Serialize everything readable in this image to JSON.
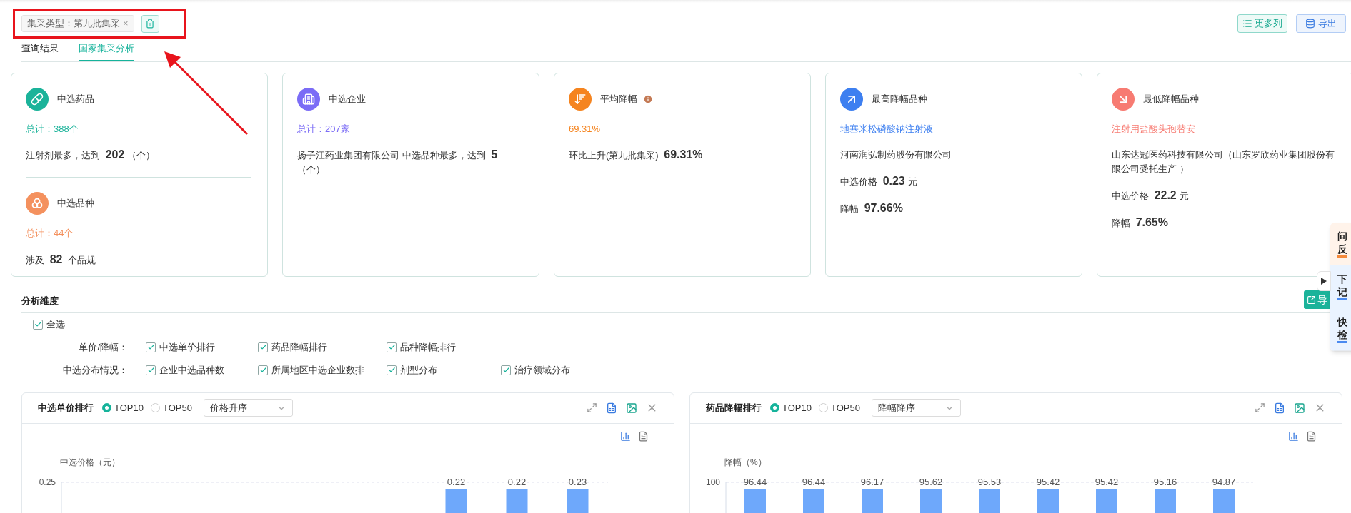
{
  "filter_bar": {
    "chips": [
      {
        "label": "集采类型：第九批集采",
        "close": "×"
      }
    ]
  },
  "toolbar": {
    "buttons": [
      {
        "label": "更多列",
        "kind": "columns"
      },
      {
        "label": "导出",
        "kind": "export"
      }
    ]
  },
  "tabs": [
    {
      "label": "查询结果",
      "selected": false
    },
    {
      "label": "国家集采分析",
      "selected": true
    }
  ],
  "cards": [
    {
      "sections": [
        {
          "title": "中选药品",
          "color": "#1bb39a",
          "highlight": "总计：388个",
          "lines": [
            "注射剂最多，达到 **202**（个）"
          ]
        },
        {
          "title": "中选品种",
          "color": "#f4915e",
          "highlight": "总计：44个",
          "lines": [
            "涉及 **82** 个品规"
          ]
        }
      ]
    },
    {
      "sections": [
        {
          "title": "中选企业",
          "color": "#7b6cf6",
          "highlight": "总计：207家",
          "lines": [
            "扬子江药业集团有限公司 中选品种最多，达到 **5**（个）"
          ]
        }
      ]
    },
    {
      "sections": [
        {
          "title": "平均降幅",
          "color": "#f5841f",
          "info": true,
          "highlight": "69.31%",
          "lines": [
            "环比上升(第九批集采) **69.31%**"
          ]
        }
      ]
    },
    {
      "sections": [
        {
          "title": "最高降幅品种",
          "color": "#3d7ff0",
          "highlight": "地塞米松磷酸钠注射液",
          "lines": [
            "河南润弘制药股份有限公司",
            "中选价格 **0.23**元",
            "降幅 **97.66%**"
          ]
        }
      ]
    },
    {
      "sections": [
        {
          "title": "最低降幅品种",
          "color": "#f77b72",
          "highlight": "注射用盐酸头孢替安",
          "lines": [
            "山东达冠医药科技有限公司（山东罗欣药业集团股份有限公司受托生产 ）",
            "中选价格 **22.2**元",
            "降幅 **7.65%**"
          ]
        }
      ]
    }
  ],
  "analysis": {
    "title": "分析维度",
    "export_button": "导",
    "select_all": {
      "label": "全选",
      "checked": true
    },
    "groups": [
      {
        "label": "单价/降幅：",
        "options": [
          {
            "label": "中选单价排行",
            "checked": true
          },
          {
            "label": "药品降幅排行",
            "checked": true
          },
          {
            "label": "品种降幅排行",
            "checked": true
          }
        ]
      },
      {
        "label": "中选分布情况：",
        "options": [
          {
            "label": "企业中选品种数",
            "checked": true
          },
          {
            "label": "所属地区中选企业数排",
            "checked": true
          },
          {
            "label": "剂型分布",
            "checked": true
          },
          {
            "label": "治疗领域分布",
            "checked": true
          }
        ]
      }
    ]
  },
  "panels": [
    {
      "title": "中选单价排行",
      "options": [
        {
          "label": "TOP10",
          "selected": true
        },
        {
          "label": "TOP50",
          "selected": false
        }
      ],
      "sort": "价格升序",
      "chart": {
        "ylabel": "中选价格（元）",
        "tick_label": "0.25",
        "bar_labels": [
          "0.22",
          "0.22",
          "0.23"
        ]
      }
    },
    {
      "title": "药品降幅排行",
      "options": [
        {
          "label": "TOP10",
          "selected": true
        },
        {
          "label": "TOP50",
          "selected": false
        }
      ],
      "sort": "降幅降序",
      "chart": {
        "ylabel": "降幅（%）",
        "tick_label": "100",
        "bar_labels": [
          "96.44",
          "96.44",
          "96.17",
          "95.62",
          "95.53",
          "95.42",
          "95.42",
          "95.16",
          "94.87"
        ]
      }
    }
  ],
  "side_panel": {
    "items": [
      {
        "lines": [
          "问",
          "反"
        ],
        "color": "#f58a3c"
      },
      {
        "lines": [
          "下",
          "记"
        ],
        "color": "#4a8af0"
      },
      {
        "lines": [
          "快",
          "检"
        ],
        "color": "#4a8af0"
      }
    ]
  }
}
